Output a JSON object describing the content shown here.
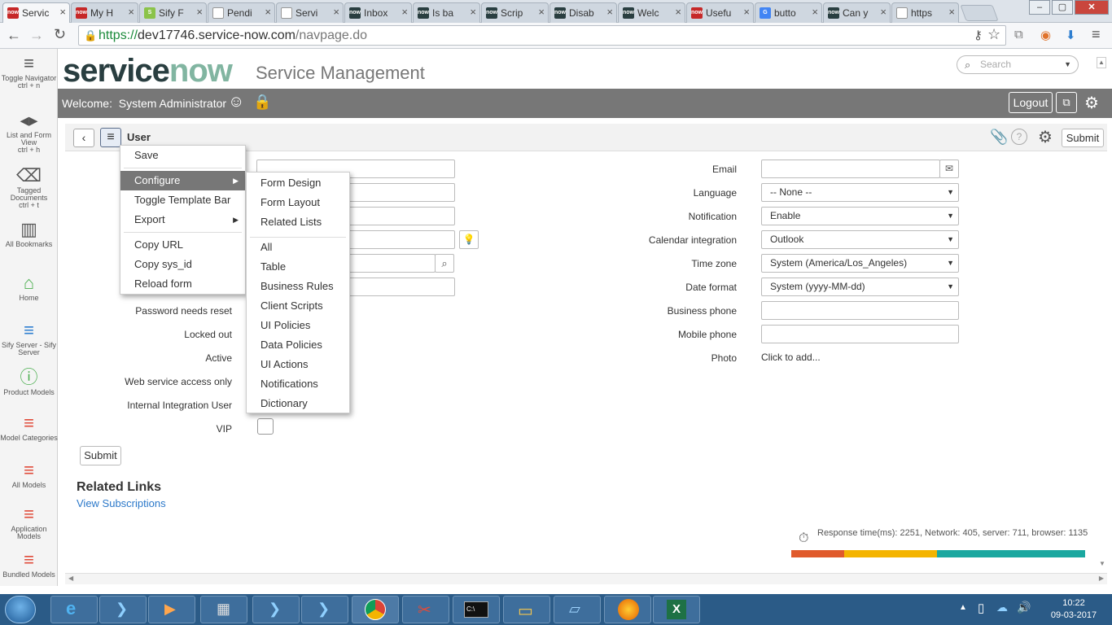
{
  "tabs": [
    {
      "label": "Servic",
      "fav_text": "now",
      "fav_color": "#c62828",
      "active": true
    },
    {
      "label": "My H",
      "fav_text": "now",
      "fav_color": "#c62828"
    },
    {
      "label": "Sify F",
      "fav_text": "S",
      "fav_color": "#8bc34a"
    },
    {
      "label": "Pendi",
      "fav_text": "",
      "fav_color": "#ffffff"
    },
    {
      "label": "Servi",
      "fav_text": "",
      "fav_color": "#ffffff"
    },
    {
      "label": "Inbox",
      "fav_text": "now",
      "fav_color": "#293e40"
    },
    {
      "label": "Is ba",
      "fav_text": "now",
      "fav_color": "#293e40"
    },
    {
      "label": "Scrip",
      "fav_text": "now",
      "fav_color": "#293e40"
    },
    {
      "label": "Disab",
      "fav_text": "now",
      "fav_color": "#293e40"
    },
    {
      "label": "Welc",
      "fav_text": "now",
      "fav_color": "#293e40"
    },
    {
      "label": "Usefu",
      "fav_text": "now",
      "fav_color": "#c62828"
    },
    {
      "label": "butto",
      "fav_text": "G",
      "fav_color": "#4285f4"
    },
    {
      "label": "Can y",
      "fav_text": "now",
      "fav_color": "#293e40"
    },
    {
      "label": "https",
      "fav_text": "",
      "fav_color": "#ffffff"
    }
  ],
  "address": {
    "scheme": "https://",
    "host": "dev17746.service-now.com",
    "path": "/navpage.do"
  },
  "leftnav": [
    {
      "icon": "≡",
      "label": "Toggle Navigator",
      "sub": "ctrl + n",
      "color": "#555"
    },
    {
      "icon": "◂▸",
      "label": "List and Form View",
      "sub": "ctrl + h",
      "color": "#555"
    },
    {
      "icon": "⌫",
      "label": "Tagged Documents",
      "sub": "ctrl + t",
      "color": "#555"
    },
    {
      "icon": "▥",
      "label": "All Bookmarks",
      "sub": "",
      "color": "#555"
    },
    {
      "icon": "⌂",
      "label": "Home",
      "sub": "",
      "color": "#4caf50"
    },
    {
      "icon": "≡",
      "label": "Sify Server - Sify Server",
      "sub": "",
      "color": "#2f7fd0"
    },
    {
      "icon": "ⓘ",
      "label": "Product Models",
      "sub": "",
      "color": "#4caf50"
    },
    {
      "icon": "≡",
      "label": "Model Categories",
      "sub": "",
      "color": "#e04b3a"
    },
    {
      "icon": "≡",
      "label": "All Models",
      "sub": "",
      "color": "#e04b3a"
    },
    {
      "icon": "≡",
      "label": "Application Models",
      "sub": "",
      "color": "#e04b3a"
    },
    {
      "icon": "≡",
      "label": "Bundled Models",
      "sub": "",
      "color": "#e04b3a"
    }
  ],
  "header": {
    "logo_service": "service",
    "logo_now": "now",
    "title": "Service Management",
    "search_placeholder": "Search",
    "welcome_label": "Welcome:",
    "user": "System Administrator",
    "logout": "Logout"
  },
  "form": {
    "title": "User",
    "submit_top": "Submit",
    "submit_bottom": "Submit",
    "left_labels": [
      "Password needs reset",
      "Locked out",
      "Active",
      "Web service access only",
      "Internal Integration User",
      "VIP"
    ],
    "right_fields": [
      {
        "label": "Email",
        "kind": "input",
        "value": ""
      },
      {
        "label": "Language",
        "kind": "select",
        "value": "-- None --"
      },
      {
        "label": "Notification",
        "kind": "select",
        "value": "Enable"
      },
      {
        "label": "Calendar integration",
        "kind": "select",
        "value": "Outlook"
      },
      {
        "label": "Time zone",
        "kind": "select",
        "value": "System (America/Los_Angeles)"
      },
      {
        "label": "Date format",
        "kind": "select",
        "value": "System (yyyy-MM-dd)"
      },
      {
        "label": "Business phone",
        "kind": "input",
        "value": ""
      },
      {
        "label": "Mobile phone",
        "kind": "input",
        "value": ""
      },
      {
        "label": "Photo",
        "kind": "text",
        "value": "Click to add..."
      }
    ],
    "related_links_title": "Related Links",
    "related_link": "View Subscriptions",
    "response_time": "Response time(ms): 2251, Network: 405, server: 711, browser: 1135",
    "timing": [
      {
        "value": 405,
        "color": "#e05a2b"
      },
      {
        "value": 711,
        "color": "#f4b400"
      },
      {
        "value": 1135,
        "color": "#1ba8a0"
      }
    ]
  },
  "context_menu": {
    "items": [
      "Save",
      "Configure",
      "Toggle Template Bar",
      "Export",
      "Copy URL",
      "Copy sys_id",
      "Reload form"
    ],
    "highlighted": "Configure"
  },
  "submenu": {
    "items": [
      "Form Design",
      "Form Layout",
      "Related Lists",
      "All",
      "Table",
      "Business Rules",
      "Client Scripts",
      "UI Policies",
      "Data Policies",
      "UI Actions",
      "Notifications",
      "Dictionary"
    ]
  },
  "taskbar": {
    "time": "10:22",
    "date": "09-03-2017"
  }
}
